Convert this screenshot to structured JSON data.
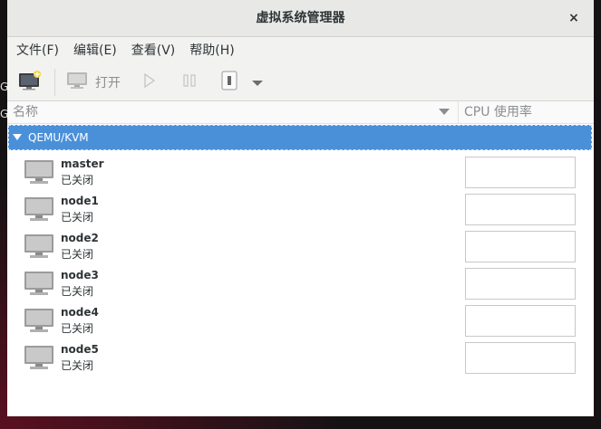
{
  "window": {
    "title": "虚拟系统管理器",
    "close_glyph": "×"
  },
  "left_peek": [
    "G",
    "G"
  ],
  "menu": [
    {
      "label": "文件(F)"
    },
    {
      "label": "编辑(E)"
    },
    {
      "label": "查看(V)"
    },
    {
      "label": "帮助(H)"
    }
  ],
  "toolbar": {
    "new_vm_icon": "new-vm-icon",
    "open_label": "打开",
    "open_icon": "monitor-icon",
    "run_icon": "play-icon",
    "pause_icon": "pause-icon",
    "shutdown_icon": "shutdown-icon",
    "menu_icon": "dropdown-arrow-icon"
  },
  "columns": {
    "name": "名称",
    "cpu": "CPU 使用率"
  },
  "connection": {
    "name": "QEMU/KVM",
    "expanded": true
  },
  "vms": [
    {
      "name": "master",
      "status": "已关闭"
    },
    {
      "name": "node1",
      "status": "已关闭"
    },
    {
      "name": "node2",
      "status": "已关闭"
    },
    {
      "name": "node3",
      "status": "已关闭"
    },
    {
      "name": "node4",
      "status": "已关闭"
    },
    {
      "name": "node5",
      "status": "已关闭"
    }
  ],
  "colors": {
    "accent": "#4a90d9",
    "titlebar": "#e8e8e7",
    "toolbar": "#f2f2f1"
  }
}
